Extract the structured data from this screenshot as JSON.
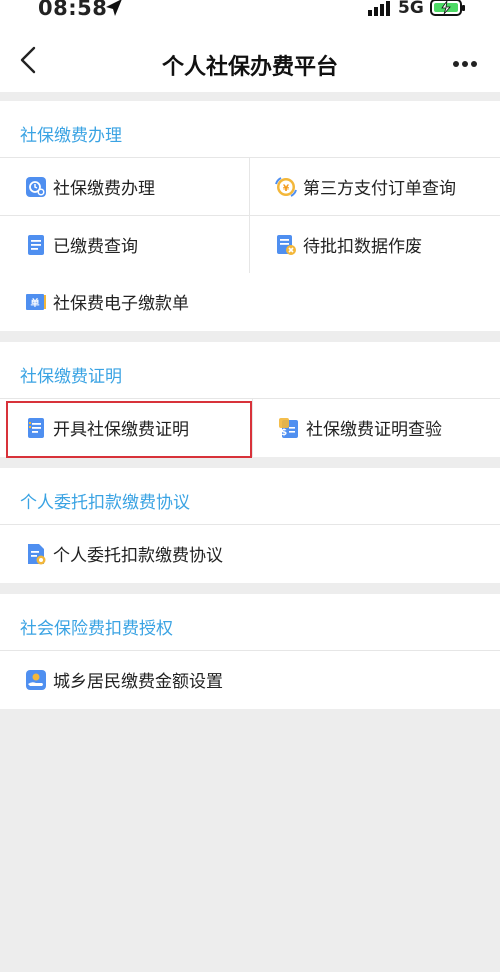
{
  "status_bar": {
    "time": "08:58",
    "network": "5G"
  },
  "nav": {
    "title": "个人社保办费平台"
  },
  "sections": [
    {
      "title": "社保缴费办理",
      "items": [
        {
          "label": "社保缴费办理",
          "icon": "clock-pay-icon"
        },
        {
          "label": "第三方支付订单查询",
          "icon": "yuan-coin-icon"
        },
        {
          "label": "已缴费查询",
          "icon": "document-list-icon"
        },
        {
          "label": "待批扣数据作废",
          "icon": "document-cancel-icon"
        },
        {
          "label": "社保费电子缴款单",
          "icon": "receipt-book-icon"
        }
      ]
    },
    {
      "title": "社保缴费证明",
      "items": [
        {
          "label": "开具社保缴费证明",
          "icon": "certificate-doc-icon"
        },
        {
          "label": "社保缴费证明查验",
          "icon": "dollar-doc-icon"
        }
      ]
    },
    {
      "title": "个人委托扣款缴费协议",
      "items": [
        {
          "label": "个人委托扣款缴费协议",
          "icon": "agreement-doc-icon"
        }
      ]
    },
    {
      "title": "社会保险费扣费授权",
      "items": [
        {
          "label": "城乡居民缴费金额设置",
          "icon": "hand-coin-icon"
        }
      ]
    }
  ],
  "colors": {
    "accent": "#3aa3e3",
    "highlight": "#d8323a",
    "background": "#ededed"
  }
}
